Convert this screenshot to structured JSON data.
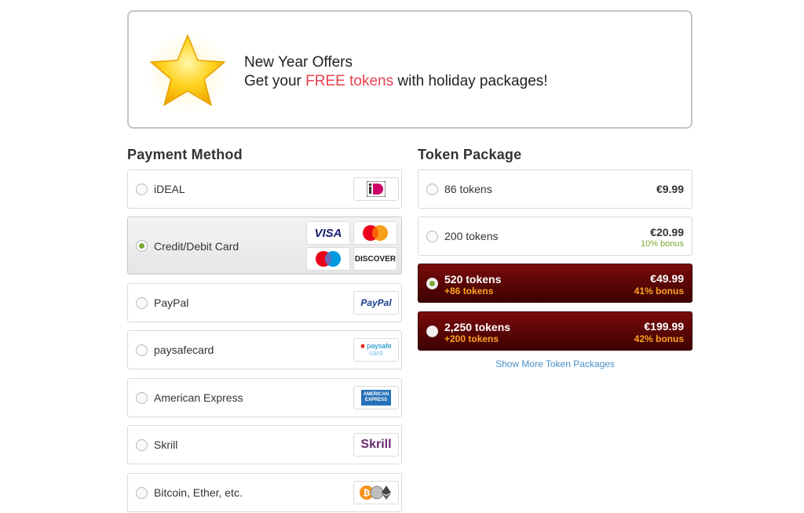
{
  "banner": {
    "title": "New Year Offers",
    "line_prefix": "Get your ",
    "line_highlight": "FREE tokens",
    "line_suffix": " with holiday packages!",
    "highlight_color": "#e8424f"
  },
  "payment": {
    "title": "Payment Method",
    "methods": [
      {
        "label": "iDEAL",
        "logo": "ideal-logo",
        "selected": false
      },
      {
        "label": "Credit/Debit Card",
        "logos": [
          "VISA",
          "mastercard-logo",
          "maestro-logo",
          "DISCOVER"
        ],
        "selected": true
      },
      {
        "label": "PayPal",
        "logo_text": "PayPal",
        "selected": false
      },
      {
        "label": "paysafecard",
        "logo_text": "paysafe",
        "logo_sub": "card",
        "selected": false
      },
      {
        "label": "American Express",
        "logo_text": "AMERICAN",
        "logo_sub": "EXPRESS",
        "selected": false
      },
      {
        "label": "Skrill",
        "logo_text": "Skrill",
        "selected": false
      },
      {
        "label": "Bitcoin, Ether, etc.",
        "logo": "crypto-logos",
        "selected": false
      }
    ]
  },
  "tokens": {
    "title": "Token Package",
    "packages": [
      {
        "label": "86 tokens",
        "price": "€9.99",
        "bonus": "",
        "extra": "",
        "selected": false
      },
      {
        "label": "200 tokens",
        "price": "€20.99",
        "bonus": "10% bonus",
        "extra": "",
        "selected": false
      },
      {
        "label": "520 tokens",
        "price": "€49.99",
        "bonus": "41% bonus",
        "extra": "+86 tokens",
        "selected": true
      },
      {
        "label": "2,250 tokens",
        "price": "€199.99",
        "bonus": "42% bonus",
        "extra": "+200 tokens",
        "selected": false
      }
    ],
    "show_more": "Show More Token Packages"
  },
  "colors": {
    "accent_green": "#7aa937",
    "dark_red": "#5a0505",
    "bonus_orange": "#ffa321",
    "link_blue": "#4a8fc4"
  }
}
